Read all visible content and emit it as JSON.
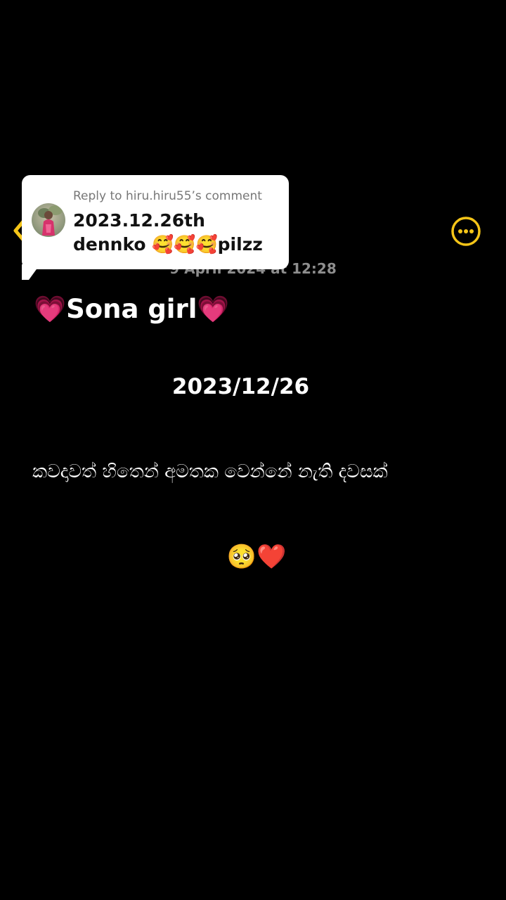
{
  "header": {
    "back_icon": "chevron-left-icon",
    "more_icon": "more-horizontal-icon",
    "accent_color": "#f5c518",
    "timestamp": "9 April 2024 at 12:28"
  },
  "reply": {
    "header": "Reply to hiru.hiru55’s comment",
    "text": "2023.12.26th\ndennko 🥰🥰🥰pilzz",
    "avatar_icon": "user-avatar"
  },
  "message": {
    "title": "💗Sona girl💗",
    "date": "2023/12/26",
    "line": "කවදාවත් හිතෙන් අමතක වෙන්නේ නැති දවසක්",
    "emoji": "🥺❤️"
  }
}
